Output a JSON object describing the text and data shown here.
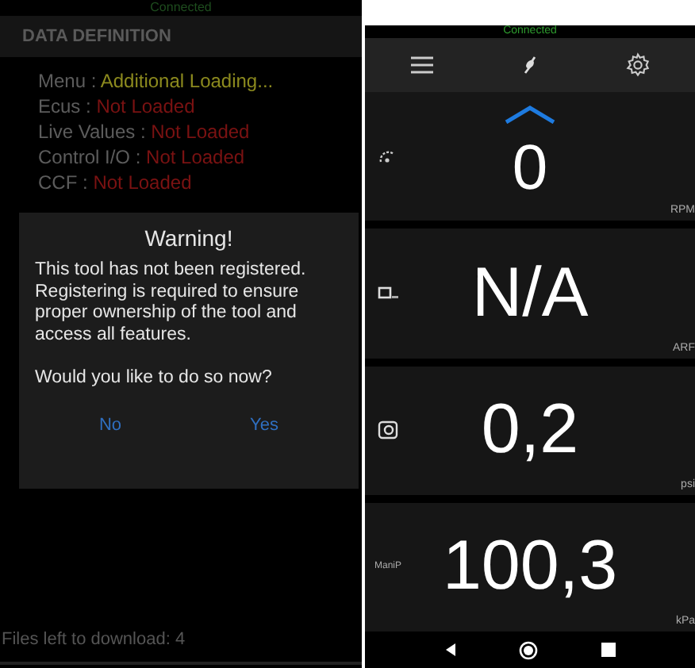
{
  "left_screen": {
    "status": "Connected",
    "header": "DATA DEFINITION",
    "definitions": [
      {
        "label": "Menu :",
        "value": "Additional Loading...",
        "color": "#8c8a1e"
      },
      {
        "label": "Ecus :",
        "value": "Not Loaded",
        "color": "#7a1212"
      },
      {
        "label": "Live Values :",
        "value": "Not Loaded",
        "color": "#7a1212"
      },
      {
        "label": "Control I/O :",
        "value": "Not Loaded",
        "color": "#7a1212"
      },
      {
        "label": "CCF :",
        "value": "Not Loaded",
        "color": "#7a1212"
      }
    ],
    "dialog": {
      "title": "Warning!",
      "message": "This tool has not been registered. Registering is required to ensure proper ownership of the tool and access all features.",
      "question": "Would you like to do so now?",
      "buttons": [
        "No",
        "Yes"
      ]
    },
    "footer": "Files left to download: 4"
  },
  "right_screen": {
    "status": "Connected",
    "gauges": [
      {
        "kind": "tach",
        "value": "0",
        "unit": "RPM",
        "trend_up": true
      },
      {
        "kind": "afr",
        "value": "N/A",
        "unit": "ARF",
        "trend_up": false
      },
      {
        "kind": "boost",
        "value": "0,2",
        "unit": "psi",
        "trend_up": false
      },
      {
        "kind": "text",
        "label": "ManiP",
        "value": "100,3",
        "unit": "kPa",
        "trend_up": false
      }
    ]
  }
}
